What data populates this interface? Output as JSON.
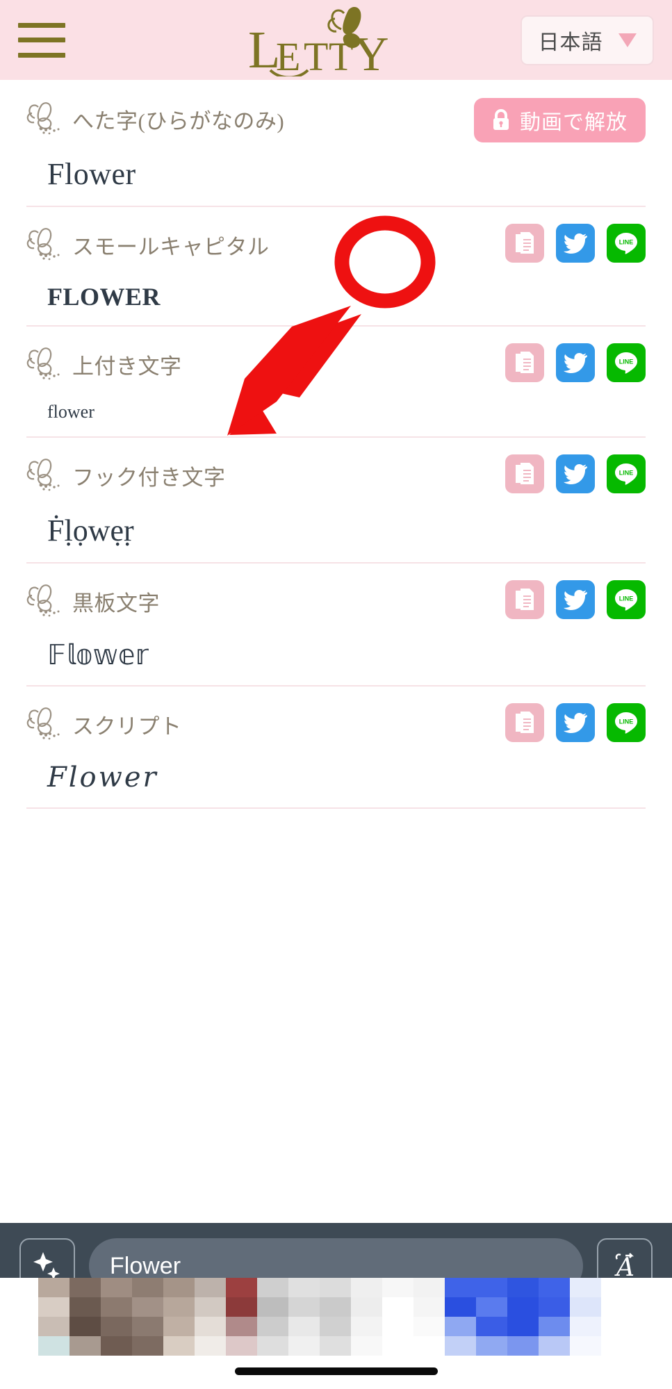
{
  "header": {
    "menu_icon": "hamburger-menu-icon",
    "brand_name": "LETTY",
    "brand_mark": "butterfly-logo",
    "language": {
      "selected": "日本語",
      "caret_icon": "chevron-down-icon"
    },
    "background_color": "#fbe0e5",
    "accent_color": "#7d7424"
  },
  "colors": {
    "header_pink": "#fbe0e5",
    "copy_pink": "#f0b6c2",
    "twitter_blue": "#3399e8",
    "line_green": "#06b900",
    "locked_pink": "#f9a2b6",
    "divider": "#f6e2e6",
    "sample_text": "#2f3a46",
    "label_brown": "#8a8070",
    "bottom_bar": "#3e4a55",
    "annotation_red": "#ee1111"
  },
  "rows": [
    {
      "label": "へた字(ひらがなのみ)",
      "sample": "Flower",
      "sample_style": "s-large",
      "locked": true,
      "lock_label": "動画で解放",
      "lock_icon": "lock-icon"
    },
    {
      "label": "スモールキャピタル",
      "sample": "FLOWER",
      "sample_style": "s-caps",
      "locked": false,
      "highlighted": true
    },
    {
      "label": "上付き文字",
      "sample": "flower",
      "sample_style": "s-small",
      "locked": false
    },
    {
      "label": "フック付き文字",
      "sample": "Ḟḷọwẹṛ",
      "sample_style": "s-hook",
      "locked": false
    },
    {
      "label": "黒板文字",
      "sample": "𝔽𝕝𝕠𝕨𝕖𝕣",
      "sample_style": "s-board",
      "locked": false
    },
    {
      "label": "スクリプト",
      "sample": "Flower",
      "sample_style": "s-script",
      "locked": false
    }
  ],
  "row_actions": {
    "copy_icon": "copy-document-icon",
    "twitter_icon": "twitter-bird-icon",
    "line_icon": "line-messenger-icon"
  },
  "annotation": {
    "shape": "red-ellipse-highlight",
    "pointer": "red-arrow",
    "target": "copy-button-row-2"
  },
  "bottom_bar": {
    "sparkle_button_icon": "sparkles-icon",
    "input_value": "Flower",
    "input_placeholder": "Flower",
    "font_button_icon": "script-letter-a-icon"
  },
  "system": {
    "home_indicator": "home-indicator-bar"
  }
}
